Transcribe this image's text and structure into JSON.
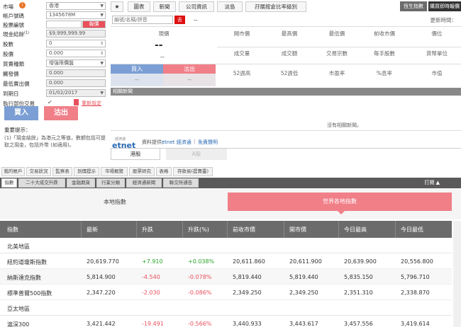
{
  "order": {
    "market_label": "市場",
    "market_value": "香港",
    "account_label": "帳戶號碼",
    "account_value": "1345678M",
    "code_label": "股票編號",
    "code_btn": "報價",
    "cash_label": "現金結餘",
    "cash_sup": "(1)",
    "cash_value": "$9,999,999.99",
    "qty_label": "股數",
    "qty_value": "0",
    "price_label": "股價",
    "price_value": "0.000",
    "ordertype_label": "買賣種類",
    "ordertype_value": "增強限價盤",
    "trigger_label": "觸發價",
    "trigger_value": "0.000",
    "stoplimit_label": "最低賣出價",
    "stoplimit_value": "0.000",
    "expiry_label": "到期日",
    "expiry_value": "01/02/2017",
    "partial_label": "執行部份交易",
    "reset_label": "重新設定",
    "buy": "買入",
    "sell": "沽出",
    "notice_title": "重要提示：",
    "notice_text": "(1)「現金結餘」為港元之等值，數額包括可提取之現金，包括外幣 (如適用)。"
  },
  "quote": {
    "tabs": [
      "圖表",
      "新聞",
      "公司資訊",
      "淡島",
      "孖展按倉比率級別"
    ],
    "index_btn": "恆生指數",
    "realtime_btn": "購買即時報價",
    "search_placeholder": "編號/名稱/拼音",
    "go": "去",
    "dash": "--",
    "update_time_label": "更新時間：",
    "price_label": "現價",
    "headers1": [
      "開市價",
      "最高價",
      "最低價",
      "前收市價",
      "價位"
    ],
    "headers2": [
      "成交量",
      "成交額",
      "交易宗數",
      "每手股數",
      "貨幣單位"
    ],
    "headers3": [
      "52週高",
      "52週低",
      "市盈率",
      "%息率",
      "市值"
    ],
    "dash_big": "--",
    "dash_small": "--",
    "buy": "買入",
    "sell": "沽出",
    "buy_val": "--",
    "sell_val": "--",
    "news_title": "相關新聞",
    "no_news": "沒有相關新聞。",
    "source_label": "資料提供：",
    "source_link": "etnet 經濟通",
    "disclaimer": "免責聲明",
    "logo_small": "經濟通",
    "logo_big": "etnet",
    "subtabs": [
      "港股",
      "A股"
    ]
  },
  "nav": [
    "我的帳戶",
    "交易狀況",
    "監察表",
    "到價提示",
    "市場概覽",
    "股票研究",
    "表格",
    "存款易(提賣靈)"
  ],
  "market_nav": [
    "指數",
    "二十大成交升跌",
    "金融期貨",
    "行業分類",
    "經濟通新聞",
    "聯交所通告"
  ],
  "expand_label": "打開 ▲",
  "index_tabs": {
    "local": "本地指數",
    "world": "世界各地指數"
  },
  "table": {
    "headers": [
      "指數",
      "最新",
      "升跌",
      "升跌(%)",
      "前收市價",
      "開市價",
      "今日最高",
      "今日最低"
    ],
    "sections": [
      {
        "name": "北美地區",
        "rows": [
          [
            "紐約道瓊斯指數",
            "20,619.770",
            "+7.910",
            "+0.038%",
            "20,611.860",
            "20,611.900",
            "20,639.900",
            "20,556.800"
          ],
          [
            "納斯達克指數",
            "5,814.900",
            "-4.540",
            "-0.078%",
            "5,819.440",
            "5,819.440",
            "5,835.150",
            "5,796.710"
          ],
          [
            "標準普爾500指數",
            "2,347.220",
            "-2.030",
            "-0.086%",
            "2,349.250",
            "2,349.250",
            "2,351.310",
            "2,338.870"
          ]
        ]
      },
      {
        "name": "亞太地區",
        "rows": [
          [
            "滬深300",
            "3,421.442",
            "-19.491",
            "-0.566%",
            "3,440.933",
            "3,443.617",
            "3,457.556",
            "3,419.614"
          ]
        ]
      }
    ]
  },
  "colors": {
    "red": "#e8505b",
    "blue": "#7b9fd4",
    "pink": "#f07f88",
    "up": "#2aa32a",
    "down": "#e8505b",
    "header_bg": "#6b6b6b"
  }
}
